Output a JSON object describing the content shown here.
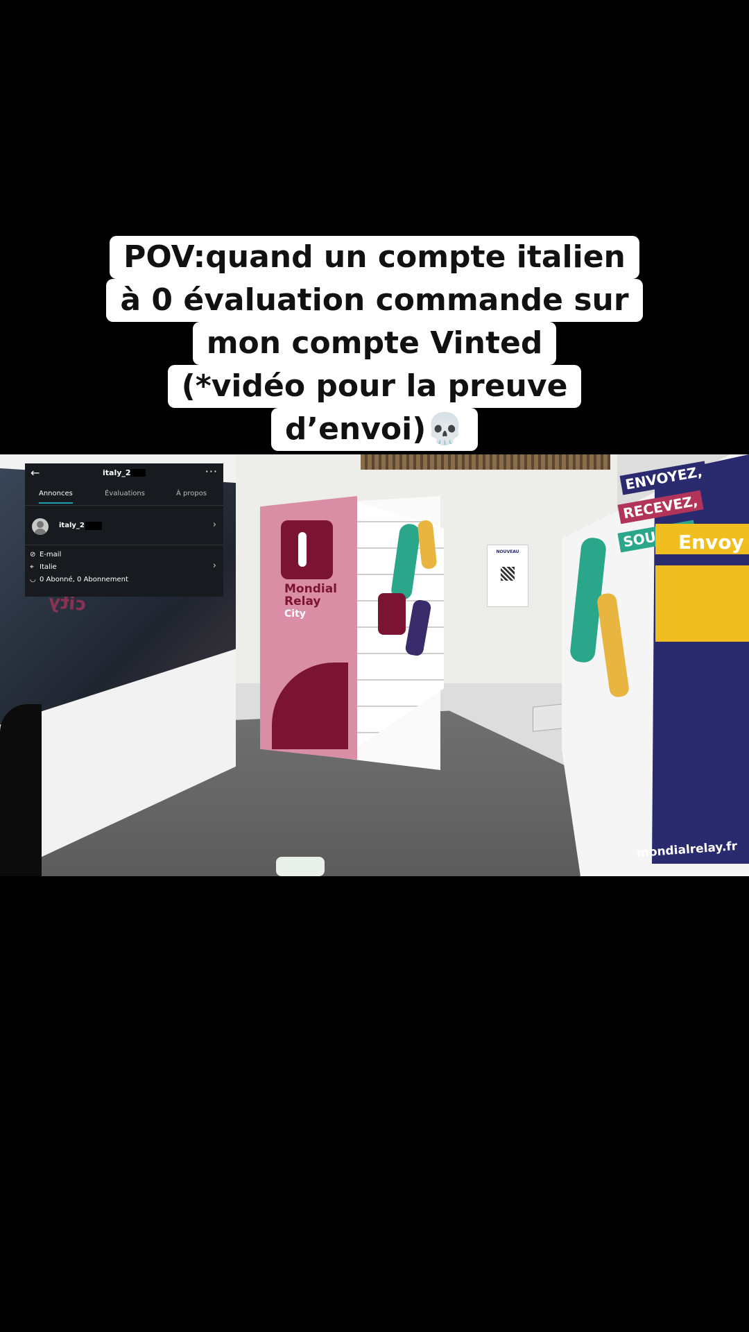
{
  "caption": {
    "lines": [
      "POV:quand un compte italien",
      "à 0 évaluation commande sur",
      "mon compte Vinted",
      "(*vidéo pour la preuve",
      "d’envoi)💀"
    ]
  },
  "scene": {
    "locker_brand": "Mondial Relay",
    "locker_sub": "City",
    "window_sign": "city",
    "slogans": [
      "ENVOYEZ,",
      "RECEVEZ,",
      "SOURIEZ"
    ],
    "envoy_label": "Envoy",
    "domain": "mondialrelay.fr",
    "poster_label": "NOUVEAU"
  },
  "profile_overlay": {
    "title": "italy_2",
    "tabs": [
      "Annonces",
      "Évaluations",
      "À propos"
    ],
    "active_tab": "Annonces",
    "username": "italy_2",
    "email_label": "E-mail",
    "location": "Italie",
    "followers": "0 Abonné, 0 Abonnement"
  },
  "colors": {
    "caption_bg": "#ffffff",
    "tab_indicator": "#1d9fad",
    "mondial_relay_primary": "#7a1432",
    "locker_navy": "#2a2a6e",
    "locker_yellow": "#f0be1e"
  }
}
